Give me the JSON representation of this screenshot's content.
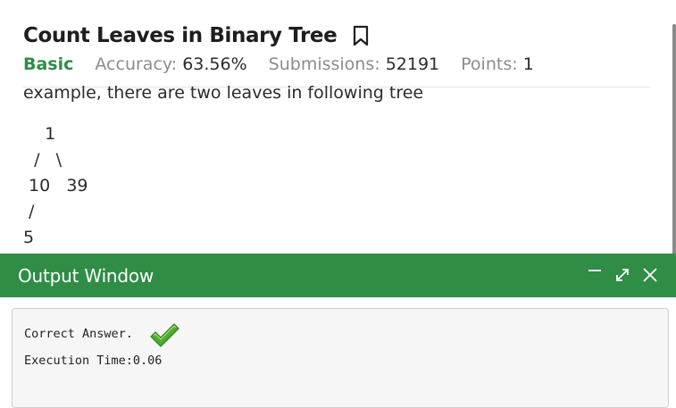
{
  "problem": {
    "title": "Count Leaves in Binary Tree",
    "difficulty": "Basic",
    "accuracy_label": "Accuracy:",
    "accuracy_value": "63.56%",
    "submissions_label": "Submissions:",
    "submissions_value": "52191",
    "points_label": "Points:",
    "points_value": "1",
    "bookmark_icon": "bookmark-icon"
  },
  "description": {
    "text": "example, there are two leaves in following tree",
    "tree": "    1\n  /   \\\n 10   39\n /\n5"
  },
  "output_window": {
    "title": "Output Window",
    "controls": [
      "minimize-icon",
      "expand-icon",
      "close-icon"
    ],
    "result": "Correct Answer.",
    "result_icon": "checkmark-icon",
    "execution_time": "Execution Time:0.06"
  },
  "colors": {
    "brand_green": "#2f8d46",
    "meta_gray": "#8c8c8c",
    "check_green": "#4caf2a"
  }
}
